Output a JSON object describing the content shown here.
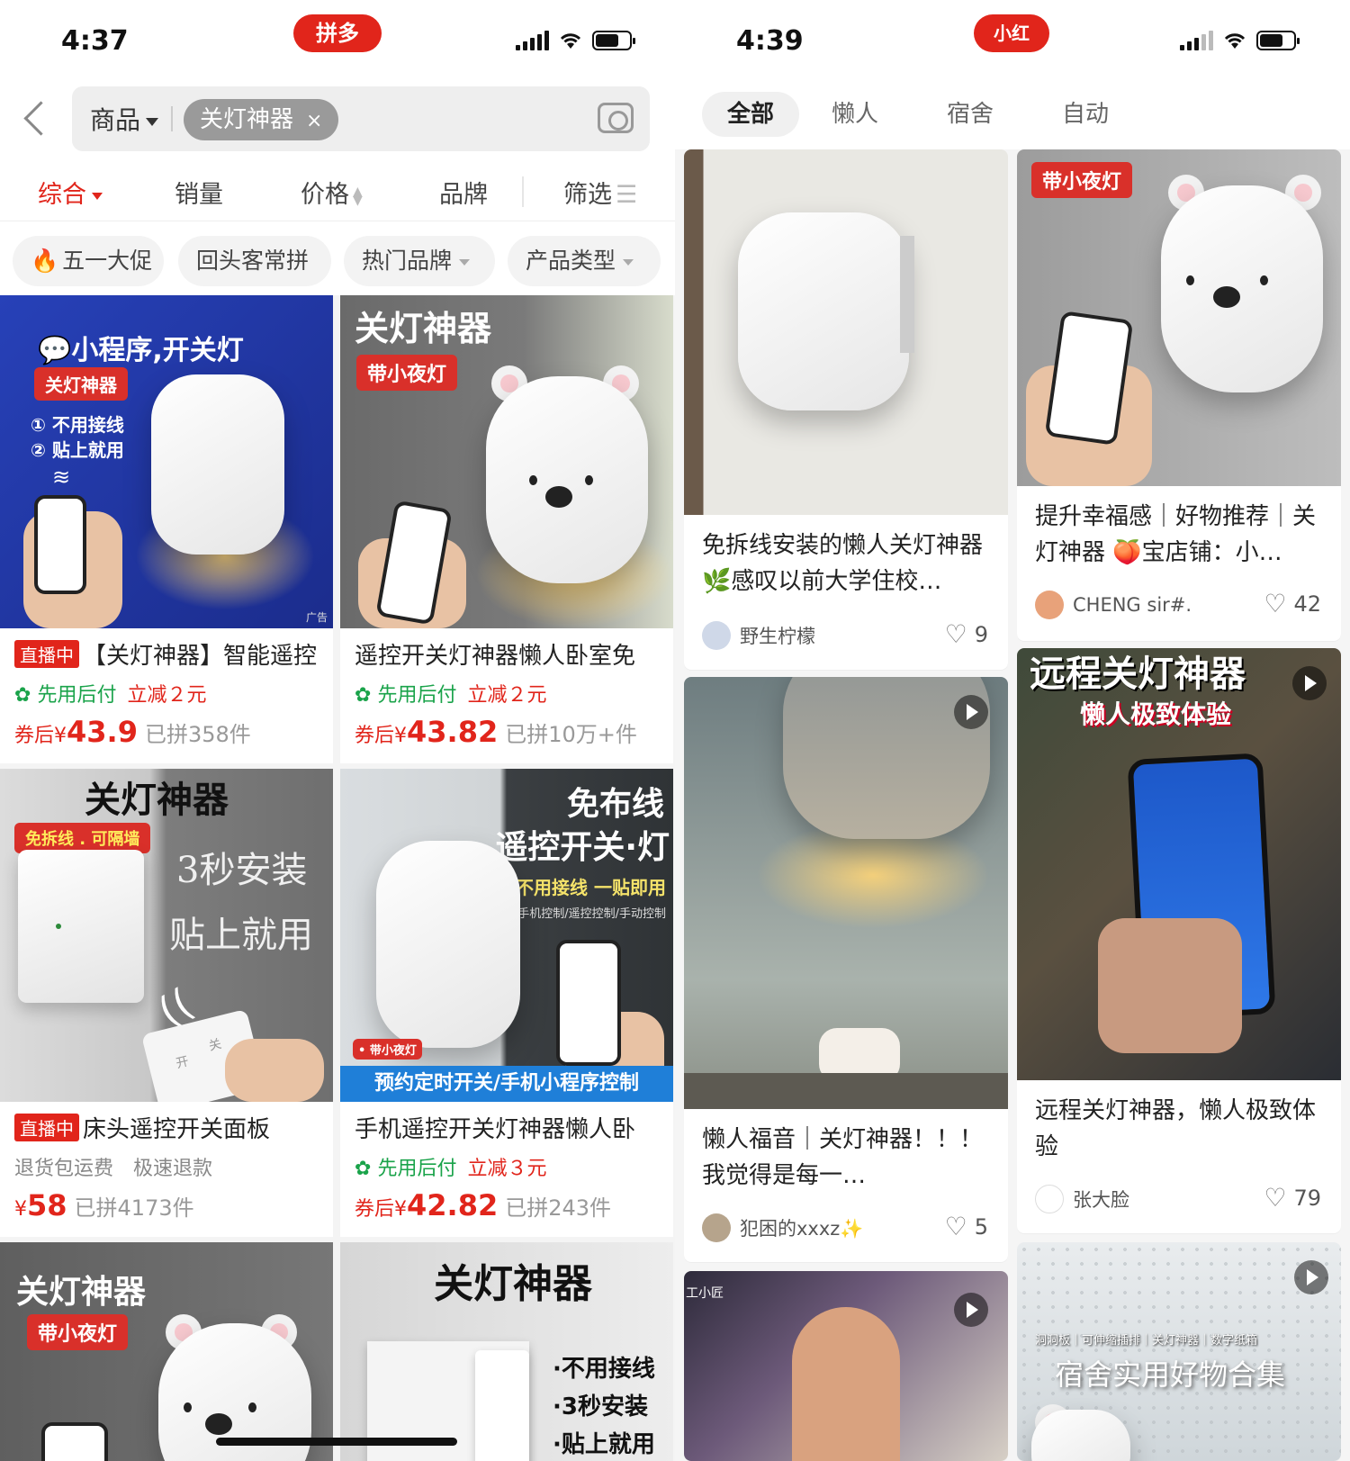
{
  "pdd": {
    "time": "4:37",
    "brand": "拼多多",
    "search": {
      "scope": "商品",
      "keyword": "关灯神器",
      "clear": "×"
    },
    "sorts": [
      "综合",
      "销量",
      "价格",
      "品牌",
      "筛选"
    ],
    "filters": [
      "五一大促",
      "回头客常拼",
      "热门品牌",
      "产品类型"
    ],
    "products": [
      {
        "badge": "直播中",
        "title": "【关灯神器】智能遥控",
        "perk": "先用后付",
        "discount": "立减２元",
        "price_prefix": "券后¥",
        "price": "43.9",
        "sold": "已拼358件",
        "img": {
          "headline": "小程序,开关灯",
          "tag": "关灯神器",
          "line1": "① 不用接线",
          "line2": "② 贴上就用",
          "ad": "广告"
        }
      },
      {
        "badge": "",
        "title": "遥控开关灯神器懒人卧室免",
        "perk": "先用后付",
        "discount": "立减２元",
        "price_prefix": "券后¥",
        "price": "43.82",
        "sold": "已拼10万+件",
        "img": {
          "headline": "关灯神器",
          "tag": "带小夜灯"
        }
      },
      {
        "badge": "直播中",
        "title": "床头遥控开关面板",
        "perk": "退货包运费　极速退款",
        "discount": "",
        "price_prefix": "¥",
        "price": "58",
        "sold": "已拼4173件",
        "img": {
          "headline": "关灯神器",
          "tag": "免拆线 . 可隔墙",
          "line1": "3秒安装",
          "line2": "贴上就用",
          "sw1": "开",
          "sw2": "关"
        }
      },
      {
        "badge": "",
        "title": "手机遥控开关灯神器懒人卧",
        "perk": "先用后付",
        "discount": "立减３元",
        "price_prefix": "券后¥",
        "price": "42.82",
        "sold": "已拼243件",
        "img": {
          "headline": "免布线",
          "line1": "遥控开关·灯",
          "line2": "不用接线 一贴即用",
          "line3": "手机控制/遥控控制/手动控制",
          "tag": "• 带小夜灯",
          "banner": "预约定时开关/手机小程序控制"
        }
      },
      {
        "img": {
          "headline": "关灯神器",
          "tag": "带小夜灯"
        }
      },
      {
        "img": {
          "headline": "关灯神器",
          "line1": "·不用接线",
          "line2": "·3秒安装",
          "line3": "·贴上就用"
        }
      }
    ]
  },
  "xhs": {
    "time": "4:39",
    "brand": "小红书",
    "tabs": [
      "全部",
      "懒人",
      "宿舍",
      "自动"
    ],
    "notes": [
      {
        "title": "免拆线安装的懒人关灯神器 🌿感叹以前大学住校…",
        "user": "野生柠檬",
        "likes": "9"
      },
      {
        "tag": "带小夜灯",
        "title": "提升幸福感｜好物推荐｜关灯神器 🍑宝店铺：小…",
        "user": "CHENG sir#.",
        "likes": "42"
      },
      {
        "title": "懒人福音｜关灯神器！！！ 我觉得是每一…",
        "user": "犯困的xxxz✨",
        "likes": "5"
      },
      {
        "overlay1": "远程关灯神器",
        "overlay2": "懒人极致体验",
        "title": "远程关灯神器，懒人极致体验",
        "user": "张大脸",
        "likes": "79"
      },
      {
        "overlay1": "工小匠"
      },
      {
        "overlay1": "洞洞板｜可伸缩插排｜关灯神器｜数字纸箱",
        "overlay2": "宿舍实用好物合集"
      }
    ]
  }
}
